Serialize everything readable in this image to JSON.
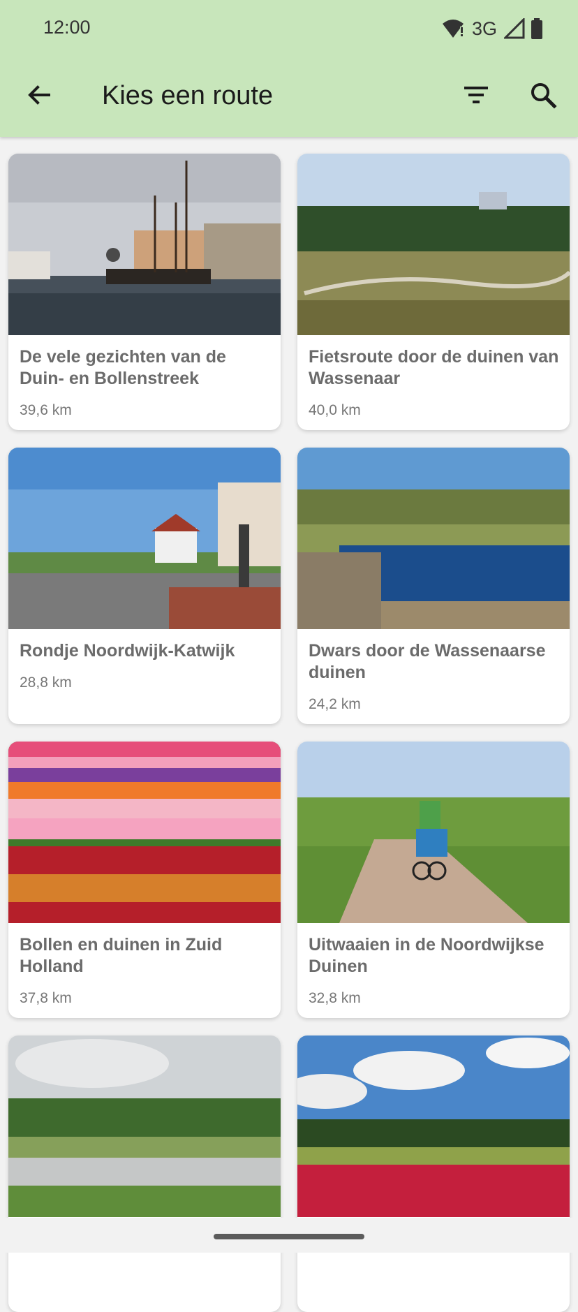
{
  "status_bar": {
    "time": "12:00",
    "network": "3G",
    "icons": [
      "wifi-alert-icon",
      "signal-icon",
      "battery-icon"
    ]
  },
  "toolbar": {
    "title": "Kies een route",
    "back_icon": "arrow-left-icon",
    "filter_icon": "filter-icon",
    "search_icon": "search-icon",
    "background": "#c8e6bb"
  },
  "routes": [
    {
      "title": "De vele gezichten van de Duin- en Bollenstreek",
      "distance": "39,6 km",
      "image": "harbor with sailing ships and windmill"
    },
    {
      "title": "Fietsroute door de duinen van Wassenaar",
      "distance": "40,0 km",
      "image": "dune landscape with cyclists"
    },
    {
      "title": "Rondje Noordwijk-Katwijk",
      "distance": "28,8 km",
      "image": "seaside boulevard with statue"
    },
    {
      "title": "Dwars door de Wassenaarse duinen",
      "distance": "24,2 km",
      "image": "pond with trees"
    },
    {
      "title": "Bollen en duinen in Zuid Holland",
      "distance": "37,8 km",
      "image": "tulip field rows"
    },
    {
      "title": "Uitwaaien in de Noordwijkse Duinen",
      "distance": "32,8 km",
      "image": "cyclist on dune path"
    },
    {
      "title": "",
      "distance": "",
      "image": "dune lake landscape"
    },
    {
      "title": "",
      "distance": "",
      "image": "tulip field under clouds"
    }
  ]
}
